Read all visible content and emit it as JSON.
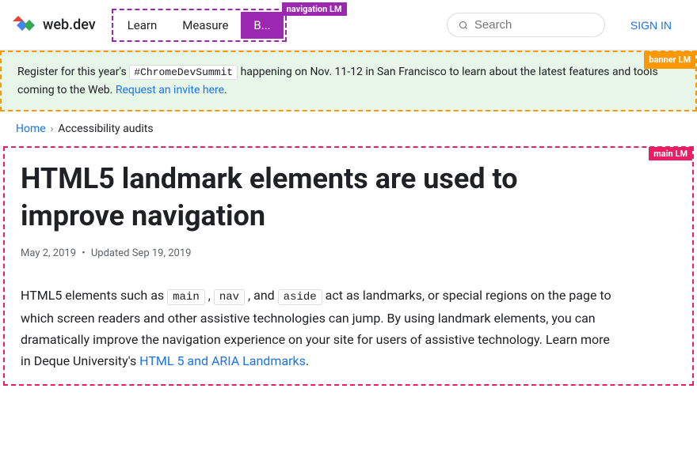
{
  "header": {
    "logo_text": "web.dev",
    "nav_items": [
      {
        "label": "Learn",
        "active": false
      },
      {
        "label": "Measure",
        "active": false
      },
      {
        "label": "B...",
        "active": true
      }
    ],
    "nav_lm": "navigation LM",
    "search_placeholder": "Search",
    "sign_in": "SIGN IN"
  },
  "banner": {
    "lm_label": "banner LM",
    "text_before": "Register for this year's ",
    "hashtag": "#ChromeDevSummit",
    "text_after": " happening on Nov. 11-12 in San Francisco to learn about the latest features and tools coming to the Web. ",
    "link_text": "Request an invite here",
    "link_period": "."
  },
  "breadcrumb": {
    "home": "Home",
    "separator": "›",
    "current": "Accessibility audits"
  },
  "main": {
    "lm_label": "main LM",
    "title": "HTML5 landmark elements are used to improve navigation",
    "date": "May 2, 2019",
    "date_dot": "•",
    "updated": "Updated Sep 19, 2019",
    "body_before": "HTML5 elements such as ",
    "code1": "main",
    "body_comma1": " , ",
    "code2": "nav",
    "body_comma2": " , and ",
    "code3": "aside",
    "body_after1": " act as landmarks, or special regions on the page to which screen readers and other assistive technologies can jump. By using landmark elements, you can dramatically improve the navigation experience on your site for users of assistive technology. Learn more in Deque University's ",
    "link_text": "HTML 5 and ARIA Landmarks",
    "body_period": "."
  }
}
